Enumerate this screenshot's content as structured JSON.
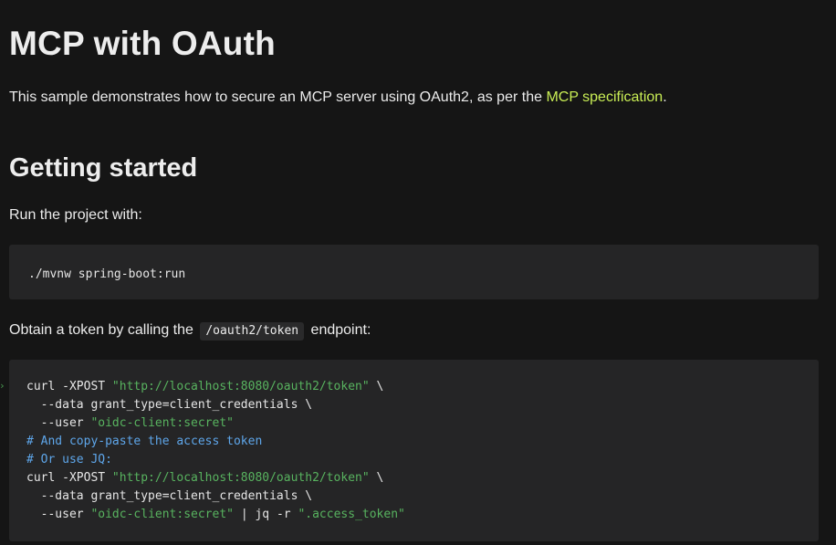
{
  "heading": {
    "title": "MCP with OAuth"
  },
  "intro": {
    "text": "This sample demonstrates how to secure an MCP server using OAuth2, as per the ",
    "link_text": "MCP specification",
    "suffix": "."
  },
  "getting_started": {
    "title": "Getting started",
    "run_text": "Run the project with:",
    "run_command": "./mvnw spring-boot:run",
    "obtain_prefix": "Obtain a token by calling the ",
    "obtain_code": "/oauth2/token",
    "obtain_suffix": " endpoint:"
  },
  "curl_block": {
    "lines": [
      [
        {
          "t": "curl -XPOST ",
          "k": "plain"
        },
        {
          "t": "\"http://localhost:8080/oauth2/token\"",
          "k": "str"
        },
        {
          "t": " \\",
          "k": "plain"
        }
      ],
      [
        {
          "t": "  --data grant_type=client_credentials \\",
          "k": "plain"
        }
      ],
      [
        {
          "t": "  --user ",
          "k": "plain"
        },
        {
          "t": "\"oidc-client:secret\"",
          "k": "str"
        }
      ],
      [
        {
          "t": "# And copy-paste the access token",
          "k": "cmt"
        }
      ],
      [
        {
          "t": "# Or use JQ:",
          "k": "cmt"
        }
      ],
      [
        {
          "t": "curl -XPOST ",
          "k": "plain"
        },
        {
          "t": "\"http://localhost:8080/oauth2/token\"",
          "k": "str"
        },
        {
          "t": " \\",
          "k": "plain"
        }
      ],
      [
        {
          "t": "  --data grant_type=client_credentials \\",
          "k": "plain"
        }
      ],
      [
        {
          "t": "  --user ",
          "k": "plain"
        },
        {
          "t": "\"oidc-client:secret\"",
          "k": "str"
        },
        {
          "t": " | jq -r ",
          "k": "plain"
        },
        {
          "t": "\".access_token\"",
          "k": "str"
        }
      ]
    ]
  },
  "colors": {
    "background": "#151515",
    "code_background": "#252526",
    "link": "#c9ee55",
    "string": "#58b35f",
    "comment": "#5ea6ea"
  }
}
